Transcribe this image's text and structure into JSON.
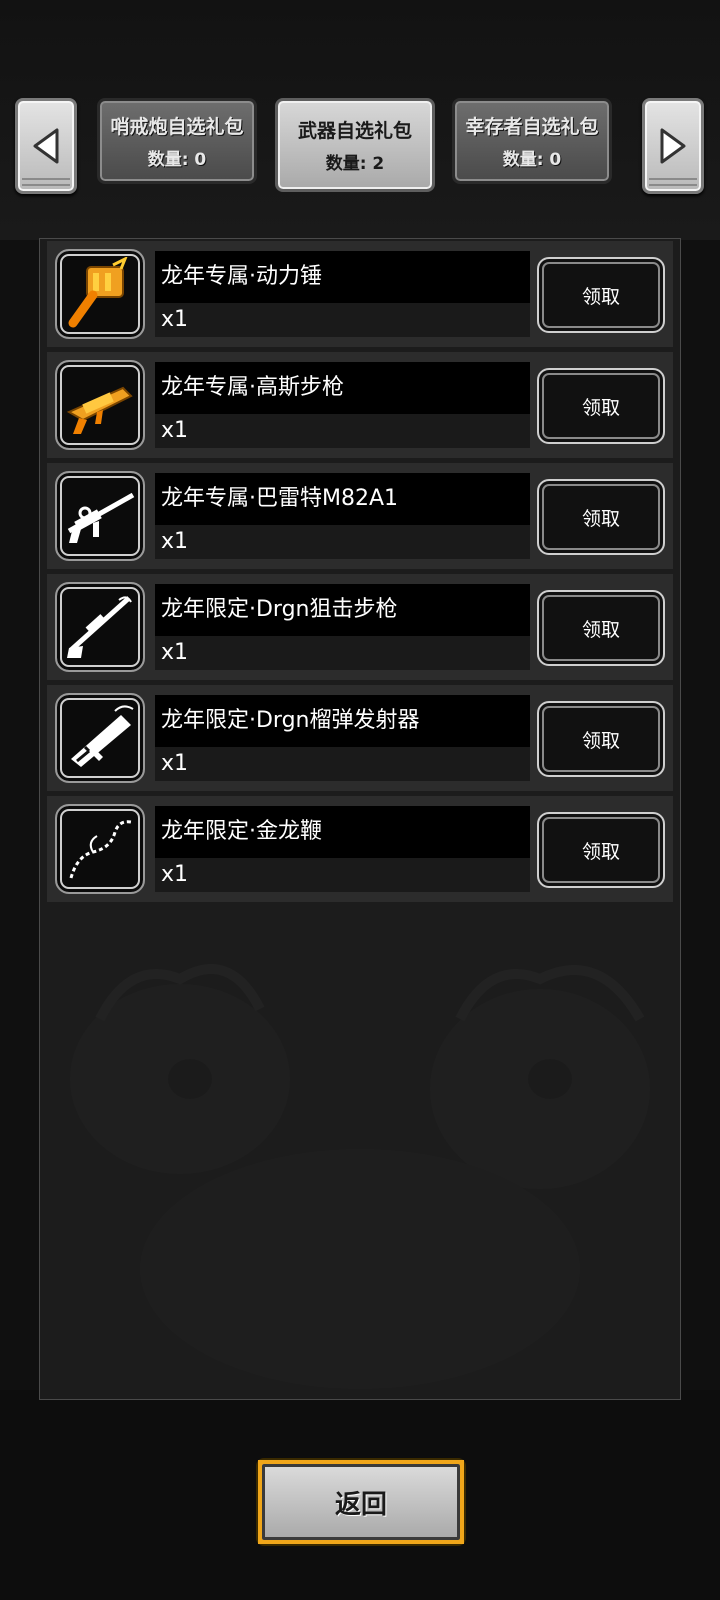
{
  "tabs": [
    {
      "name": "哨戒炮自选礼包",
      "count": "数量: 0",
      "active": false
    },
    {
      "name": "武器自选礼包",
      "count": "数量: 2",
      "active": true
    },
    {
      "name": "幸存者自选礼包",
      "count": "数量: 0",
      "active": false
    }
  ],
  "rewards": [
    {
      "name": "龙年专属·动力锤",
      "qty": "x1",
      "claim": "领取",
      "icon": "power-hammer-icon",
      "color": "#f0a020"
    },
    {
      "name": "龙年专属·高斯步枪",
      "qty": "x1",
      "claim": "领取",
      "icon": "gauss-rifle-icon",
      "color": "#f0a020"
    },
    {
      "name": "龙年专属·巴雷特M82A1",
      "qty": "x1",
      "claim": "领取",
      "icon": "barrett-rifle-icon",
      "color": "#ffffff"
    },
    {
      "name": "龙年限定·Drgn狙击步枪",
      "qty": "x1",
      "claim": "领取",
      "icon": "sniper-rifle-icon",
      "color": "#ffffff"
    },
    {
      "name": "龙年限定·Drgn榴弹发射器",
      "qty": "x1",
      "claim": "领取",
      "icon": "grenade-launcher-icon",
      "color": "#ffffff"
    },
    {
      "name": "龙年限定·金龙鞭",
      "qty": "x1",
      "claim": "领取",
      "icon": "golden-dragon-whip-icon",
      "color": "#ffffff"
    }
  ],
  "footer": {
    "return_label": "返回"
  }
}
